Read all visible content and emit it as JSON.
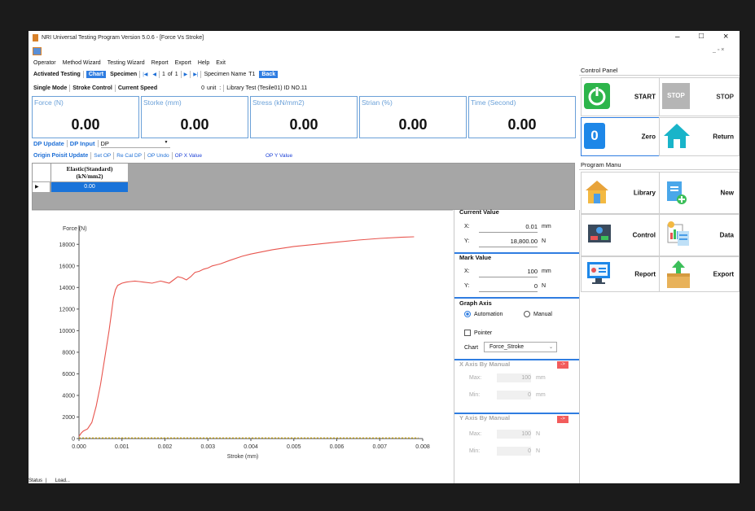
{
  "window": {
    "title": "NRI Universal Testing Program Version 5.0.6 - [Force Vs Stroke]",
    "minimize": "–",
    "maximize": "□",
    "close": "×",
    "mdi_controls": "_ ▫ ×"
  },
  "menu": [
    "Operator",
    "Method Wizard",
    "Testing Wizard",
    "Report",
    "Export",
    "Help",
    "Exit"
  ],
  "toolbar": {
    "activated_testing": "Activated Testing",
    "chart": "Chart",
    "specimen": "Specimen",
    "first": "|◀",
    "prev": "◀",
    "page": "1",
    "of": "of",
    "total": "1",
    "next": "▶",
    "last": "▶|",
    "specimen_name_label": "Specimen Name",
    "specimen_name": "T1",
    "back": "Back"
  },
  "modebar": {
    "single_mode": "Single Mode",
    "stroke_control": "Stroke Control",
    "current_speed": "Current Speed",
    "speed_value": "0",
    "unit": "unit",
    "colon": ":",
    "library_info": "Library Test (Tesile01) ID NO.11"
  },
  "stats": [
    {
      "label": "Force (N)",
      "value": "0.00"
    },
    {
      "label": "Storke (mm)",
      "value": "0.00"
    },
    {
      "label": "Stress (kN/mm2)",
      "value": "0.00"
    },
    {
      "label": "Strian (%)",
      "value": "0.00"
    },
    {
      "label": "Time (Second)",
      "value": "0.00"
    }
  ],
  "dp": {
    "update": "DP Update",
    "input": "DP Input",
    "select_value": "DP"
  },
  "op": {
    "update": "Origin Poisit Update",
    "set": "Set OP",
    "recal": "Re Cal DP",
    "undo": "OP Undo",
    "x_value": "OP X Value",
    "y_value": "OP Y Value"
  },
  "grid": {
    "header_line1": "Elastic(Standard)",
    "header_line2": "(kN/mm2)",
    "row_marker": "▶",
    "cell": "0.00"
  },
  "chart_data": {
    "type": "line",
    "xlabel": "Stroke (mm)",
    "ylabel": "Force (N)",
    "xlim": [
      0,
      0.008
    ],
    "ylim": [
      0,
      19000
    ],
    "xticks": [
      "0.000",
      "0.001",
      "0.002",
      "0.003",
      "0.004",
      "0.005",
      "0.006",
      "0.007",
      "0.008"
    ],
    "yticks": [
      "0",
      "2000",
      "4000",
      "6000",
      "8000",
      "10000",
      "12000",
      "14000",
      "16000",
      "18000"
    ],
    "series": [
      {
        "color": "#e8554e",
        "x": [
          0,
          5e-05,
          0.0001,
          0.0002,
          0.0003,
          0.0004,
          0.0005,
          0.0006,
          0.0007,
          0.00075,
          0.0008,
          0.00085,
          0.0009,
          0.001,
          0.0011,
          0.0012,
          0.0013,
          0.0014,
          0.0015,
          0.0017,
          0.0019,
          0.002,
          0.0021,
          0.0022,
          0.0023,
          0.0024,
          0.0025,
          0.0026,
          0.0027,
          0.0028,
          0.0029,
          0.003,
          0.0031,
          0.0032,
          0.0033,
          0.0035,
          0.0038,
          0.004,
          0.0045,
          0.005,
          0.0055,
          0.006,
          0.0065,
          0.007,
          0.0075,
          0.0078
        ],
        "y": [
          200,
          500,
          700,
          900,
          1500,
          3000,
          5000,
          7500,
          10000,
          11500,
          13000,
          13800,
          14200,
          14400,
          14500,
          14550,
          14600,
          14550,
          14500,
          14400,
          14600,
          14500,
          14400,
          14700,
          15000,
          14900,
          14700,
          15000,
          15400,
          15500,
          15700,
          15800,
          16000,
          16100,
          16200,
          16500,
          16900,
          17100,
          17500,
          17800,
          18000,
          18200,
          18400,
          18550,
          18650,
          18700
        ]
      },
      {
        "color": "#c9a000",
        "style": "dashed",
        "x": [
          0,
          0.0079
        ],
        "y": [
          60,
          60
        ]
      }
    ]
  },
  "current_value": {
    "title": "Current Value",
    "x_label": "X:",
    "x_value": "0.01",
    "x_unit": "mm",
    "y_label": "Y:",
    "y_value": "18,800.00",
    "y_unit": "N"
  },
  "mark_value": {
    "title": "Mark Value",
    "x_label": "X:",
    "x_value": "100",
    "x_unit": "mm",
    "y_label": "Y:",
    "y_value": "0",
    "y_unit": "N"
  },
  "graph_axis": {
    "title": "Graph Axis",
    "automation": "Automation",
    "manual": "Manual",
    "pointer": "Pointer",
    "chart_label": "Chart",
    "chart_value": "Force_Stroke"
  },
  "x_axis_manual": {
    "title": "X Axis By Manual",
    "arrow": "->",
    "max_label": "Max:",
    "max_value": "100",
    "max_unit": "mm",
    "min_label": "Min:",
    "min_value": "0",
    "min_unit": "mm"
  },
  "y_axis_manual": {
    "title": "Y Axis By Manual",
    "arrow": "->",
    "max_label": "Max:",
    "max_value": "100",
    "max_unit": "N",
    "min_label": "Min:",
    "min_value": "0",
    "min_unit": "N"
  },
  "control_panel": {
    "title": "Control Panel",
    "start": "START",
    "stop": "STOP",
    "stop_sign": "STOP",
    "zero": "Zero",
    "zero_glyph": "0",
    "return": "Return"
  },
  "program_menu": {
    "title": "Program Manu",
    "library": "Library",
    "new": "New",
    "control": "Control",
    "data": "Data",
    "report": "Report",
    "export": "Export"
  },
  "statusbar": {
    "status": "Status",
    "pipe": "|",
    "loaded": "Load..."
  }
}
